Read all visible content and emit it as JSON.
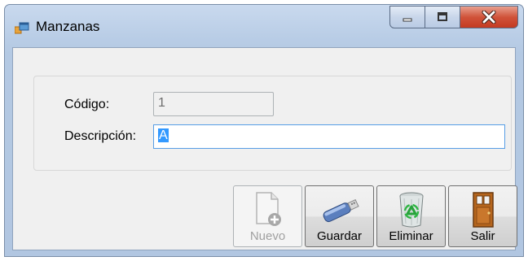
{
  "window": {
    "title": "Manzanas"
  },
  "form": {
    "codigo_label": "Código:",
    "codigo_value": "1",
    "descripcion_label": "Descripción:",
    "descripcion_value": "A"
  },
  "buttons": {
    "nuevo": "Nuevo",
    "guardar": "Guardar",
    "eliminar": "Eliminar",
    "salir": "Salir"
  }
}
